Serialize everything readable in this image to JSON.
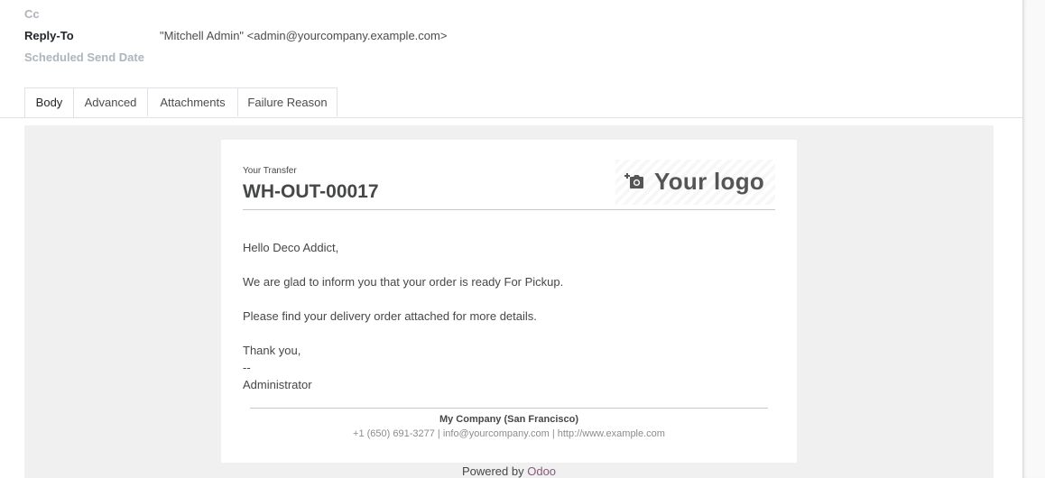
{
  "fields": {
    "cc_label": "Cc",
    "reply_to_label": "Reply-To",
    "reply_to_value": "\"Mitchell Admin\" <admin@yourcompany.example.com>",
    "scheduled_label": "Scheduled Send Date"
  },
  "tabs": [
    {
      "label": "Body",
      "active": true
    },
    {
      "label": "Advanced",
      "active": false
    },
    {
      "label": "Attachments",
      "active": false
    },
    {
      "label": "Failure Reason",
      "active": false
    }
  ],
  "email": {
    "header_small": "Your Transfer",
    "header_name": "WH-OUT-00017",
    "logo_text": "Your logo",
    "logo_icon": "camera-plus-icon",
    "greeting": "Hello Deco Addict,",
    "line1": "We are glad to inform you that your order is ready For Pickup.",
    "line2": "Please find your delivery order attached for more details.",
    "thanks": "Thank you,",
    "sig_sep": "--",
    "signature": "Administrator",
    "company": "My Company (San Francisco)",
    "contact": "+1 (650) 691-3277 | info@yourcompany.com | http://www.example.com"
  },
  "footer": {
    "powered_prefix": "Powered by",
    "powered_link": "Odoo"
  },
  "colors": {
    "link": "#875a7b",
    "body_bg": "#f0f0f0"
  }
}
